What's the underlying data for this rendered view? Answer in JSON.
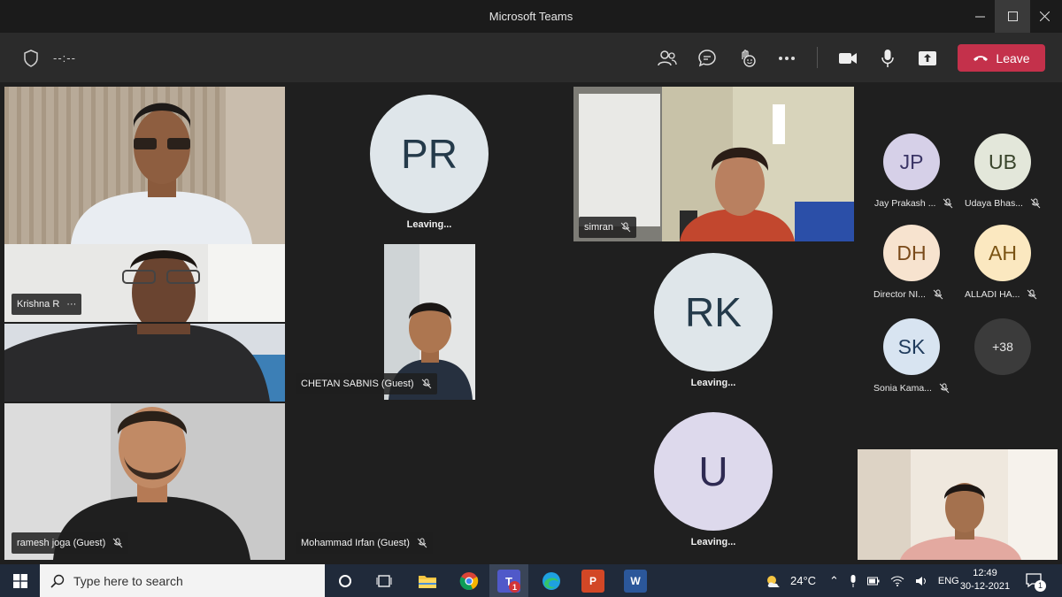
{
  "window": {
    "title": "Microsoft Teams",
    "minimize_icon": "minimize-icon",
    "maximize_icon": "maximize-icon",
    "close_icon": "close-icon"
  },
  "meeting_bar": {
    "timer": "--:--",
    "leave_label": "Leave",
    "colors": {
      "leave": "#c4314b",
      "bar": "#2b2b2b"
    },
    "icons": [
      "shield-icon",
      "participants-icon",
      "chat-icon",
      "reactions-icon",
      "more-icon",
      "camera-icon",
      "microphone-icon",
      "share-icon",
      "phone-icon"
    ]
  },
  "tiles": {
    "krishna": {
      "name": "Krishna R",
      "more": "···"
    },
    "pr": {
      "initials": "PR",
      "status": "Leaving..."
    },
    "simran": {
      "name": "simran"
    },
    "chetan": {
      "name": "CHETAN SABNIS (Guest)"
    },
    "rk": {
      "initials": "RK",
      "status": "Leaving..."
    },
    "u": {
      "initials": "U",
      "status": "Leaving..."
    },
    "ramesh": {
      "name": "ramesh joga (Guest)"
    },
    "irfan": {
      "name": "Mohammad Irfan (Guest)"
    }
  },
  "gallery": {
    "people": [
      {
        "initials": "JP",
        "name": "Jay Prakash ...",
        "bg": "#d6d0e8",
        "fg": "#3b3566"
      },
      {
        "initials": "UB",
        "name": "Udaya Bhas...",
        "bg": "#e3e7da",
        "fg": "#39442b"
      },
      {
        "initials": "DH",
        "name": "Director NI...",
        "bg": "#f7e3cf",
        "fg": "#7a4a1a"
      },
      {
        "initials": "AH",
        "name": "ALLADI HA...",
        "bg": "#fbe8c0",
        "fg": "#7a5313"
      },
      {
        "initials": "SK",
        "name": "Sonia Kama...",
        "bg": "#d8e4f1",
        "fg": "#1f3b5c"
      }
    ],
    "overflow": "+38"
  },
  "taskbar": {
    "search_placeholder": "Type here to search",
    "weather": "24°C",
    "language": "ENG",
    "time": "12:49",
    "date": "30-12-2021",
    "teams_badge": "1",
    "notification_badge": "1",
    "apps": [
      "cortana-icon",
      "task-view-icon",
      "file-explorer-icon",
      "chrome-icon",
      "teams-icon",
      "edge-icon",
      "powerpoint-icon",
      "word-icon"
    ]
  }
}
